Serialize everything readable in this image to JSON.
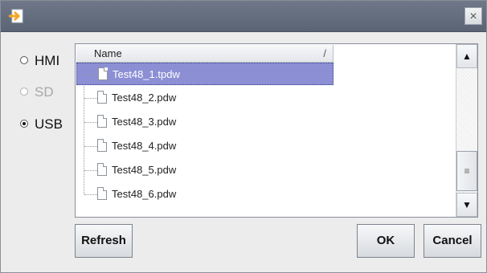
{
  "title_bar": {
    "app_icon": "import-arrow-icon",
    "close_label": "×"
  },
  "storage": {
    "options": [
      {
        "label": "HMI",
        "selected": false,
        "disabled": false
      },
      {
        "label": "SD",
        "selected": false,
        "disabled": true
      },
      {
        "label": "USB",
        "selected": true,
        "disabled": false
      }
    ]
  },
  "file_list": {
    "column_header": "Name",
    "sort_indicator": "/",
    "files": [
      {
        "name": "Test48_1.tpdw",
        "selected": true
      },
      {
        "name": "Test48_2.pdw",
        "selected": false
      },
      {
        "name": "Test48_3.pdw",
        "selected": false
      },
      {
        "name": "Test48_4.pdw",
        "selected": false
      },
      {
        "name": "Test48_5.pdw",
        "selected": false
      },
      {
        "name": "Test48_6.pdw",
        "selected": false
      }
    ],
    "scroll_up_glyph": "▲",
    "scroll_down_glyph": "▼",
    "scroll_thumb_glyph": "≡"
  },
  "buttons": {
    "refresh": "Refresh",
    "ok": "OK",
    "cancel": "Cancel"
  },
  "colors": {
    "selection": "#8c8fd4",
    "titlebar": "#5f6879",
    "icon_accent": "#f5a623"
  }
}
